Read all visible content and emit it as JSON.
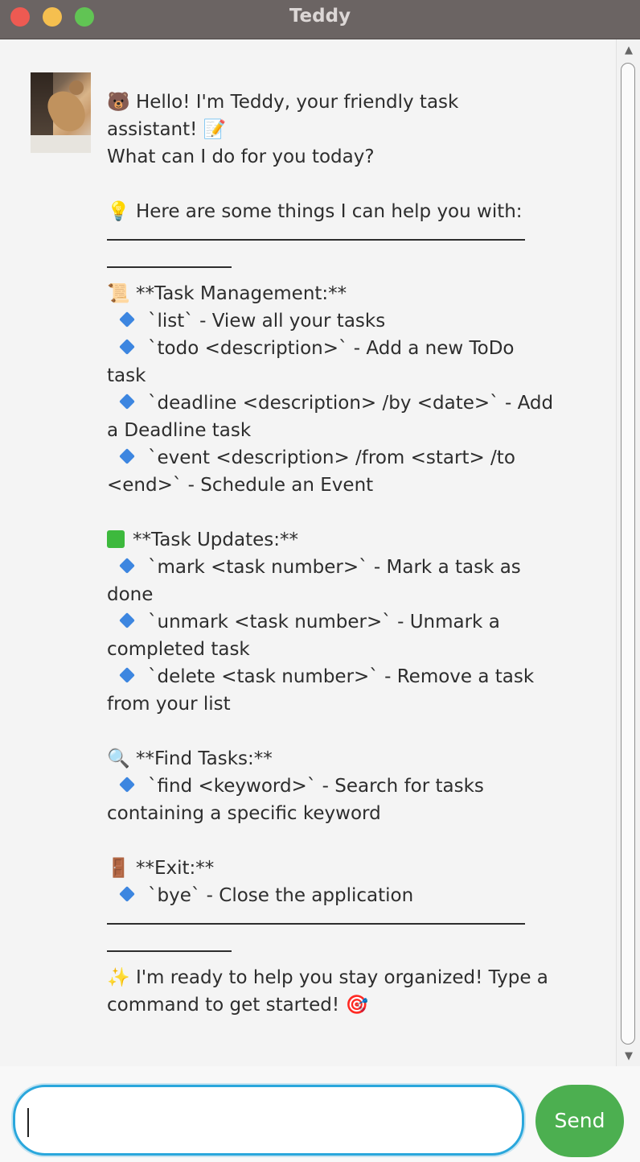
{
  "window": {
    "title": "Teddy"
  },
  "message": {
    "lines": [
      "🐻 Hello! I'm Teddy, your friendly task",
      "assistant! 📝",
      "What can I do for you today?",
      "💡 Here are some things I can help you with:",
      "📜 **Task Management:**",
      "`list` - View all your tasks",
      "`todo <description>` - Add a new ToDo",
      "task",
      "`deadline <description> /by <date>` - Add",
      "a Deadline task",
      "`event <description> /from <start> /to",
      "<end>` - Schedule an Event",
      "**Task Updates:**",
      "`mark <task number>` - Mark a task as",
      "done",
      "`unmark <task number>` - Unmark a",
      "completed task",
      "`delete <task number>` - Remove a task",
      "from your list",
      "🔍 **Find Tasks:**",
      "`find <keyword>` - Search for tasks",
      "containing a specific keyword",
      "🚪 **Exit:**",
      "`bye` - Close the application",
      "✨ I'm ready to help you stay organized! Type a",
      "command to get started! 🎯"
    ]
  },
  "input": {
    "value": ""
  },
  "send_button": {
    "label": "Send"
  },
  "colors": {
    "send": "#4caf50",
    "input_border": "#2aa7dc",
    "titlebar": "#6b6463"
  }
}
